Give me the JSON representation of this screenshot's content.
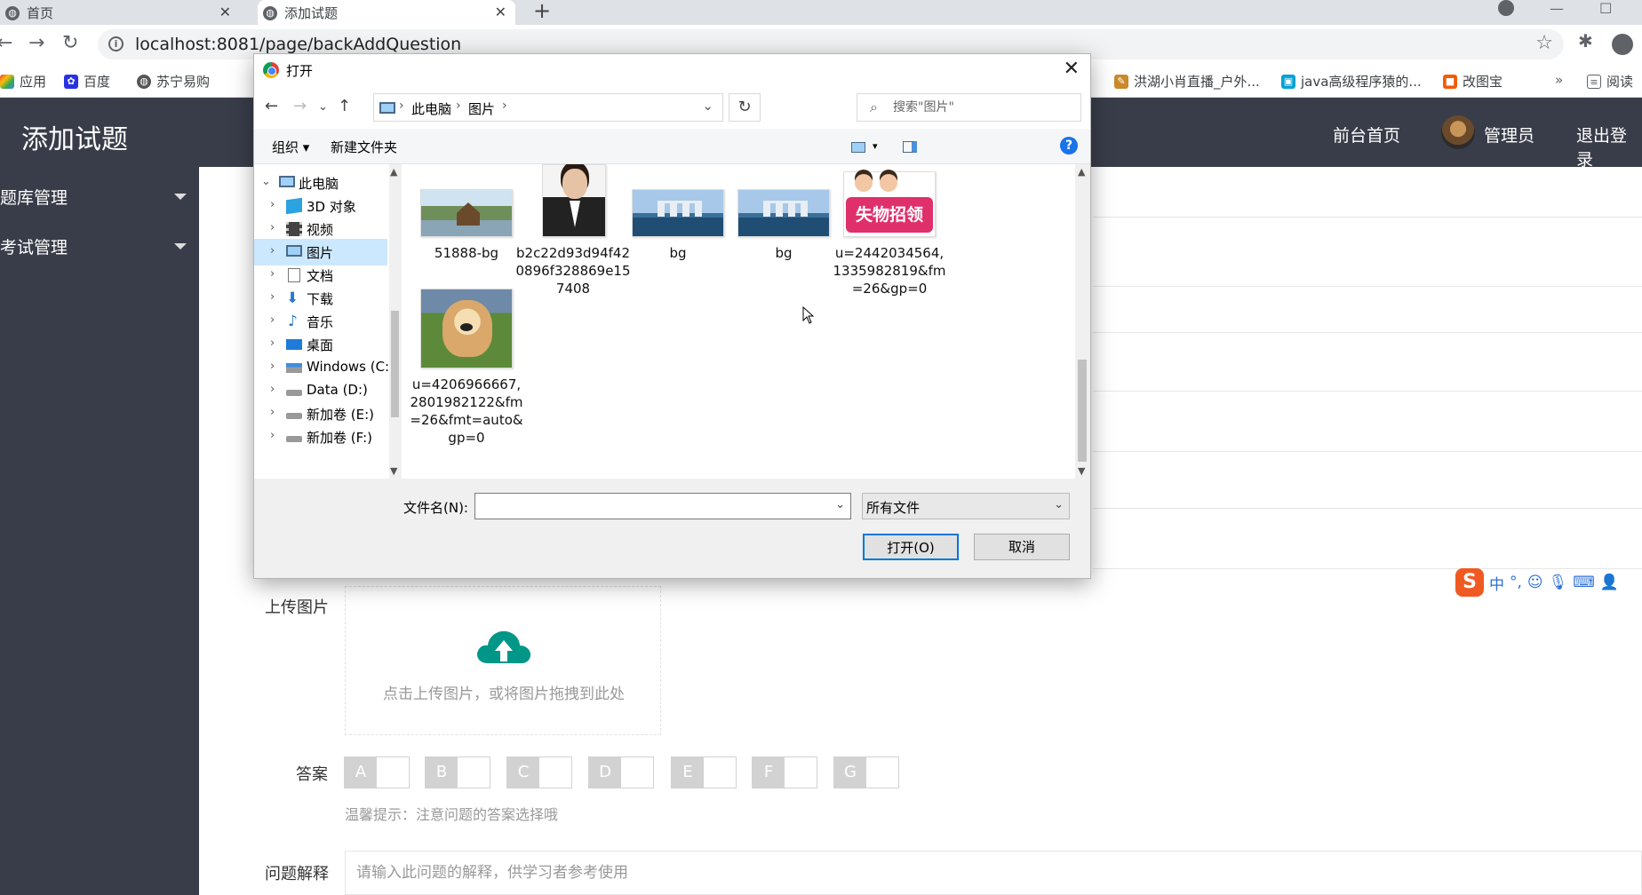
{
  "browser": {
    "tabs": [
      {
        "label": "首页",
        "active": false
      },
      {
        "label": "添加试题",
        "active": true
      }
    ],
    "url": "localhost:8081/page/backAddQuestion",
    "bookmarks": [
      {
        "label": "应用"
      },
      {
        "label": "百度"
      },
      {
        "label": "苏宁易购"
      },
      {
        "label": "洪湖小肖直播_户外..."
      },
      {
        "label": "java高级程序猿的..."
      },
      {
        "label": "改图宝"
      },
      {
        "label": "阅读"
      }
    ]
  },
  "page": {
    "brand": "添加试题",
    "nav": {
      "home": "前台首页",
      "user": "管理员",
      "logout": "退出登录"
    },
    "sidebar": [
      {
        "label": "题库管理"
      },
      {
        "label": "考试管理"
      }
    ],
    "form": {
      "upload_label": "上传图片",
      "upload_hint": "点击上传图片，或将图片拖拽到此处",
      "answer_label": "答案",
      "answer_options": [
        "A",
        "B",
        "C",
        "D",
        "E",
        "F",
        "G"
      ],
      "tip": "温馨提示：注意问题的答案选择哦",
      "explain_label": "问题解释",
      "explain_placeholder": "请输入此问题的解释，供学习者参考使用"
    },
    "ime": {
      "logo": "S",
      "lang": "中"
    }
  },
  "dialog": {
    "title": "打开",
    "breadcrumb": [
      "此电脑",
      "图片"
    ],
    "search_placeholder": "搜索\"图片\"",
    "toolbar": {
      "organize": "组织 ▾",
      "new_folder": "新建文件夹",
      "help": "?"
    },
    "tree": [
      {
        "label": "此电脑",
        "expanded": true,
        "selected": false,
        "level": 0
      },
      {
        "label": "3D 对象",
        "selected": false,
        "level": 1
      },
      {
        "label": "视频",
        "selected": false,
        "level": 1
      },
      {
        "label": "图片",
        "selected": true,
        "level": 1
      },
      {
        "label": "文档",
        "selected": false,
        "level": 1
      },
      {
        "label": "下载",
        "selected": false,
        "level": 1
      },
      {
        "label": "音乐",
        "selected": false,
        "level": 1
      },
      {
        "label": "桌面",
        "selected": false,
        "level": 1
      },
      {
        "label": "Windows (C:)",
        "selected": false,
        "level": 1
      },
      {
        "label": "Data (D:)",
        "selected": false,
        "level": 1
      },
      {
        "label": "新加卷 (E:)",
        "selected": false,
        "level": 1
      },
      {
        "label": "新加卷 (F:)",
        "selected": false,
        "level": 1
      }
    ],
    "files": [
      {
        "name": "51888-bg",
        "thumb": "house-lake"
      },
      {
        "name": "b2c22d93d94f420896f328869e157408",
        "thumb": "portrait"
      },
      {
        "name": "bg",
        "thumb": "skyline"
      },
      {
        "name": "bg",
        "thumb": "skyline"
      },
      {
        "name": "u=2442034564,1335982819&fm=26&gp=0",
        "thumb": "lost-found-sign",
        "thumb_text": "失物招领"
      },
      {
        "name": "u=4206966667,2801982122&fm=26&fmt=auto&gp=0",
        "thumb": "puppy"
      }
    ],
    "filename_label": "文件名(N):",
    "filename_value": "",
    "filetype": "所有文件",
    "open_button": "打开(O)",
    "cancel_button": "取消"
  }
}
